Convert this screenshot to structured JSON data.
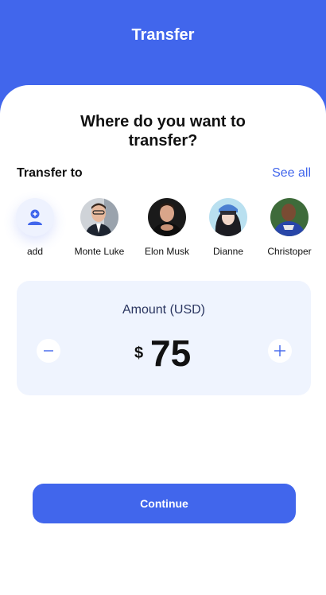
{
  "header": {
    "title": "Transfer"
  },
  "main": {
    "headline": "Where do you want to transfer?",
    "transfer_to_label": "Transfer to",
    "see_all_label": "See all"
  },
  "recipients": [
    {
      "name": "add",
      "icon": "add-user-icon"
    },
    {
      "name": "Monte Luke"
    },
    {
      "name": "Elon Musk"
    },
    {
      "name": "Dianne"
    },
    {
      "name": "Christoper"
    }
  ],
  "amount": {
    "label": "Amount (USD)",
    "currency_symbol": "$",
    "value": "75",
    "decrement_icon": "minus-icon",
    "increment_icon": "plus-icon"
  },
  "actions": {
    "continue_label": "Continue"
  },
  "colors": {
    "accent": "#4166EC",
    "panel": "#EFF4FE"
  }
}
